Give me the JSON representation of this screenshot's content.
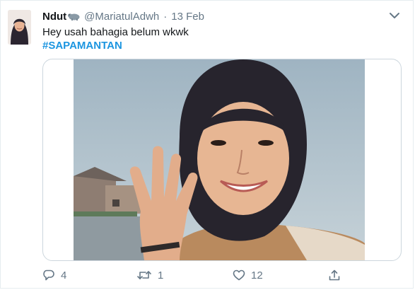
{
  "tweet": {
    "display_name": "Ndut",
    "handle": "@MariatulAdwh",
    "separator": "·",
    "date": "13 Feb",
    "text_line1": "Hey usah bahagia belum wkwk",
    "hashtag": "#SAPAMANTAN",
    "name_emoji_icon": "hippo-icon"
  },
  "actions": {
    "reply_count": "4",
    "retweet_count": "1",
    "like_count": "12",
    "reply_icon": "reply-icon",
    "retweet_icon": "retweet-icon",
    "like_icon": "heart-icon",
    "share_icon": "share-icon"
  },
  "colors": {
    "link_blue": "#1b95e0",
    "muted_gray": "#657786",
    "border": "#ccd6dd"
  }
}
